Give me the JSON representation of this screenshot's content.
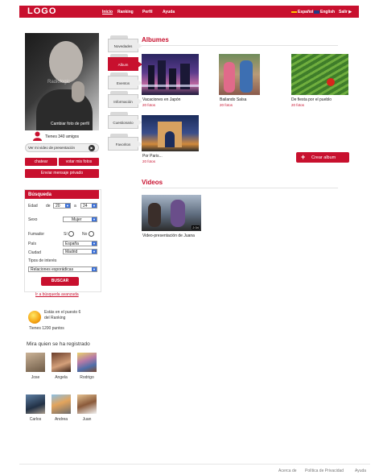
{
  "header": {
    "logo": "LOGO",
    "nav": [
      "Inicio",
      "Ranking",
      "Perfil",
      "Ayuda"
    ],
    "lang_es": "Español",
    "lang_en": "English",
    "exit": "Salir"
  },
  "profile": {
    "watermark": "Radiologic",
    "change_photo": "Cambiar foto de perfil",
    "friends": "Tienes 340 amigos",
    "video_button": "Ver mi video de presentación",
    "chat_button": "chatear",
    "vote_button": "votar mis fotos",
    "message_button": "Enviar mensaje privado"
  },
  "search": {
    "title": "Búsqueda",
    "age_label": "Edad",
    "age_from_label": "de",
    "age_from": "20",
    "age_to_label": "a",
    "age_to": "24",
    "sex_label": "Sexo",
    "sex_value": "Mujer",
    "smoker_label": "Fumador",
    "smoker_yes": "Sí",
    "smoker_no": "No",
    "country_label": "País",
    "country_value": "España",
    "city_label": "Ciudad",
    "city_value": "Madrid",
    "interest_label": "Tipos de interés",
    "interest_value": "Relaciones esporádicas",
    "submit": "BUSCAR",
    "advanced_link": "Ir a búsqueda avanzada"
  },
  "ranking": {
    "position_line1": "Estás en el puesto 6",
    "position_line2": "del Ranking",
    "points": "Tienes 1200 puntos"
  },
  "recent": {
    "title": "Mira quien se ha registrado",
    "users": [
      "Jose",
      "Angela",
      "Rodrigo",
      "Carlos",
      "Andrea",
      "Juan"
    ]
  },
  "tabs": [
    "Novedades",
    "Album",
    "Eventos",
    "Información",
    "Cuestionario",
    "Favoritos"
  ],
  "albums": {
    "title": "Albumes",
    "items": [
      {
        "name": "Vacaciones en Japón",
        "count": "20 fotos"
      },
      {
        "name": "Bailando Salsa",
        "count": "20 fotos"
      },
      {
        "name": "De fiesta por el pueblo",
        "count": "20 fotos"
      },
      {
        "name": "Por Paris...",
        "count": "20 fotos"
      }
    ],
    "create_button": "Crear album"
  },
  "videos": {
    "title": "Videos",
    "items": [
      {
        "name": "Video-presentación de Juana",
        "duration": "2:34"
      }
    ]
  },
  "footer": {
    "links": [
      "Acerca de",
      "Política de Privacidad",
      "Ayuda"
    ]
  },
  "colors": {
    "brand": "#c8102e",
    "select_arrow": "#3a6fd6"
  }
}
